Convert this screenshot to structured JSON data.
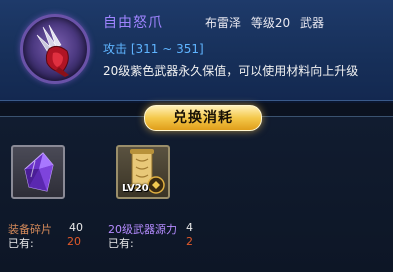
{
  "item": {
    "name": "自由怒爪",
    "character": "布雷泽",
    "level": "等级20",
    "type": "武器",
    "attack": "攻击 [311 ~ 351]",
    "description": "20级紫色武器永久保值，可以使用材料向上升级",
    "rarity_color": "#9f84ff"
  },
  "section": {
    "title": "兑换消耗"
  },
  "materials": [
    {
      "name": "装备碎片",
      "required": "40",
      "owned_label": "已有:",
      "owned": "20",
      "icon": "purple-crystal-icon"
    },
    {
      "name": "20级武器源力",
      "required": "4",
      "owned_label": "已有:",
      "owned": "2",
      "icon": "weapon-source-scroll-icon",
      "badge": "LV20"
    }
  ],
  "colors": {
    "attack": "#5fb4ff",
    "insufficient": "#e05a2a",
    "banner": "#f4c84a"
  }
}
